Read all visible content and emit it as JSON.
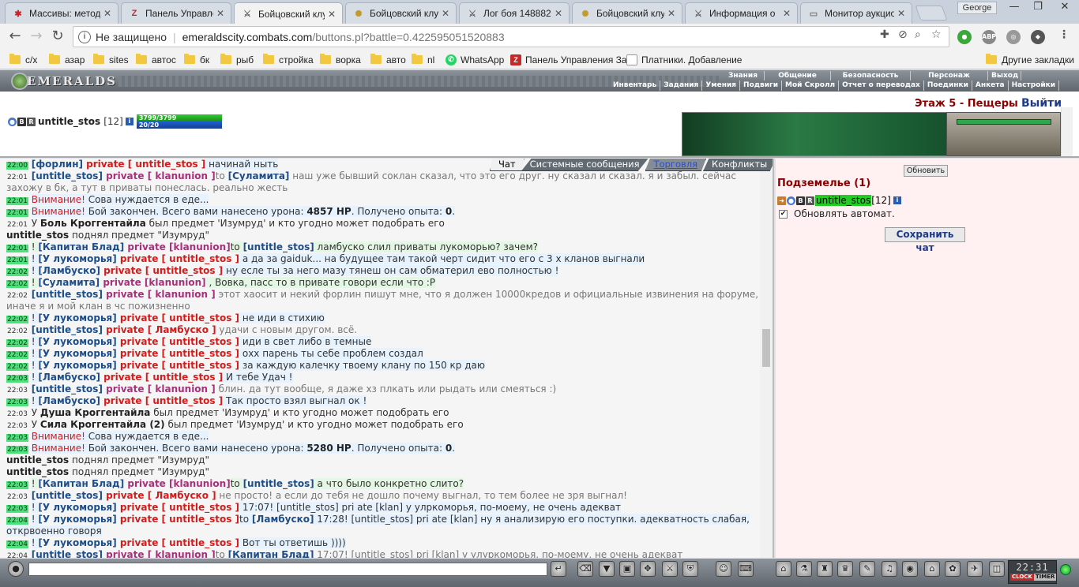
{
  "browser": {
    "tabs": [
      {
        "title": "Массивы: метод",
        "icon_color": "#c62828",
        "icon_glyph": "✱"
      },
      {
        "title": "Панель Управле",
        "icon_color": "#c62828",
        "icon_glyph": "Z"
      },
      {
        "title": "Бойцовский клу",
        "icon_color": "#666666",
        "icon_glyph": "⚔",
        "active": true
      },
      {
        "title": "Бойцовский клу",
        "icon_color": "#c29a2a",
        "icon_glyph": "✺"
      },
      {
        "title": "Лог боя 148882",
        "icon_color": "#666666",
        "icon_glyph": "⚔"
      },
      {
        "title": "Бойцовский клу",
        "icon_color": "#c29a2a",
        "icon_glyph": "✺"
      },
      {
        "title": "Информация о",
        "icon_color": "#666666",
        "icon_glyph": "⚔"
      },
      {
        "title": "Монитор аукцио",
        "icon_color": "#777777",
        "icon_glyph": "▭"
      }
    ],
    "profile_name": "George",
    "address": {
      "security_label": "Не защищено",
      "host": "emeraldscity.combats.com",
      "path": "/buttons.pl?battle=0.422595051520883"
    },
    "bookmarks": [
      {
        "label": "с/х",
        "type": "folder"
      },
      {
        "label": "азар",
        "type": "folder"
      },
      {
        "label": "sites",
        "type": "folder"
      },
      {
        "label": "автос",
        "type": "folder"
      },
      {
        "label": "бк",
        "type": "folder"
      },
      {
        "label": "рыб",
        "type": "folder"
      },
      {
        "label": "стройка",
        "type": "folder"
      },
      {
        "label": "ворка",
        "type": "folder"
      },
      {
        "label": "авто",
        "type": "folder"
      },
      {
        "label": "nl",
        "type": "folder"
      },
      {
        "label": "WhatsApp",
        "type": "whatsapp"
      },
      {
        "label": "Панель Управления За",
        "type": "panel"
      },
      {
        "label": "Платники. Добавление",
        "type": "page"
      }
    ],
    "other_bookmarks": "Другие закладки"
  },
  "game": {
    "logo_text": "EMERALDS",
    "menu_top": [
      "Знания",
      "Общение",
      "Безопасность",
      "Персонаж",
      "Выход"
    ],
    "menu_bottom": [
      "Инвентарь",
      "Задания",
      "Умения",
      "Подвиги",
      "Мой Скролл",
      "Отчет о переводах",
      "Поединки",
      "Анкета",
      "Настройки"
    ],
    "player": {
      "name": "untitle_stos",
      "level": "[12]",
      "hp": "3799/3799",
      "mp": "20/20",
      "hp_fraction": 1.0,
      "mp_fraction": 1.0
    },
    "location": "Этаж 5 - Пещеры",
    "exit_label": "Выйти",
    "chat_tabs": [
      "Чат",
      "Системные сообщения",
      "Торговля",
      "Конфликты"
    ],
    "right_panel": {
      "refresh_label": "Обновить",
      "room_title": "Подземелье (1)",
      "room_user": "untitle_stos",
      "room_user_level": "[12]",
      "auto_refresh_label": "Обновлять автомат.",
      "save_chat_label": "Сохранить чат"
    },
    "clock": {
      "time": "22:31",
      "label_clock": "CLOCK",
      "label_timer": "TIMER"
    }
  },
  "chat": [
    {
      "time": "22:00",
      "hl": true,
      "segs": [
        {
          "c": "nick",
          "t": "[форлин]"
        },
        {
          "c": "priv",
          "t": " private [ untitle_stos ]"
        },
        {
          "c": "",
          "t": " начинай ныть"
        }
      ]
    },
    {
      "time": "22:01",
      "segs": [
        {
          "c": "nick",
          "t": "[untitle_stos]"
        },
        {
          "c": "privp",
          "t": " private [ klanunion ]"
        },
        {
          "c": "grey",
          "t": "to "
        },
        {
          "c": "nick",
          "t": "[Суламита]"
        },
        {
          "c": "grey",
          "t": " наш уже бывший соклан сказал, что это его друг. ну сказал и сказал. я и забыл. сейчас захожу в бк, а тут в приваты понеслась. реально жесть"
        }
      ]
    },
    {
      "time": "22:01",
      "hl": true,
      "segs": [
        {
          "c": "warn",
          "t": "Внимание!"
        },
        {
          "c": "",
          "t": " Сова нуждается в еде..."
        }
      ]
    },
    {
      "time": "22:01",
      "hl": true,
      "segs": [
        {
          "c": "warn",
          "t": "Внимание!"
        },
        {
          "c": "",
          "t": " Бой закончен. Всего вами нанесено урона: "
        },
        {
          "c": "bold",
          "t": "4857 HP"
        },
        {
          "c": "",
          "t": ". Получено опыта: "
        },
        {
          "c": "bold",
          "t": "0"
        },
        {
          "c": "",
          "t": "."
        }
      ]
    },
    {
      "time": "22:01",
      "segs": [
        {
          "c": "",
          "t": "У "
        },
        {
          "c": "bold",
          "t": "Боль Кроггентайла"
        },
        {
          "c": "",
          "t": " был предмет 'Изумруд' и кто угодно может подобрать его"
        }
      ]
    },
    {
      "time": "",
      "segs": [
        {
          "c": "bold",
          "t": "untitle_stos"
        },
        {
          "c": "",
          "t": " поднял предмет \"Изумруд\""
        }
      ]
    },
    {
      "time": "22:01",
      "hlg": true,
      "segs": [
        {
          "c": "",
          "t": "! "
        },
        {
          "c": "nick",
          "t": "[Капитан Блад]"
        },
        {
          "c": "privp",
          "t": " private [klanunion]"
        },
        {
          "c": "",
          "t": "to "
        },
        {
          "c": "nick",
          "t": "[untitle_stos]"
        },
        {
          "c": "",
          "t": " ламбуско слил приваты лукоморью? зачем?"
        }
      ]
    },
    {
      "time": "22:01",
      "hl": true,
      "segs": [
        {
          "c": "",
          "t": "! "
        },
        {
          "c": "nick",
          "t": "[У лукоморья]"
        },
        {
          "c": "priv",
          "t": " private [ untitle_stos ]"
        },
        {
          "c": "",
          "t": " а да за gaiduk... на будущее там такой черт сидит что его с 3 х кланов выгнали"
        }
      ]
    },
    {
      "time": "22:02",
      "hl": true,
      "segs": [
        {
          "c": "",
          "t": "! "
        },
        {
          "c": "nick",
          "t": "[Ламбуско]"
        },
        {
          "c": "priv",
          "t": " private [ untitle_stos ]"
        },
        {
          "c": "",
          "t": " ну есле ты за него мазу тянеш он сам обматерил ево полностью !"
        }
      ]
    },
    {
      "time": "22:02",
      "hlg": true,
      "segs": [
        {
          "c": "",
          "t": "! "
        },
        {
          "c": "nick",
          "t": "[Суламита]"
        },
        {
          "c": "privp",
          "t": " private [klanunion]"
        },
        {
          "c": "",
          "t": " , Вовка, пасс то в привате говори если что :P"
        }
      ]
    },
    {
      "time": "22:02",
      "segs": [
        {
          "c": "nick",
          "t": "[untitle_stos]"
        },
        {
          "c": "privp",
          "t": " private [ klanunion ]"
        },
        {
          "c": "grey",
          "t": " этот хаосит и некий форлин пишут мне, что я должен 10000кредов и официальные извинения на форуме, иначе я и мой клан в чс пожизненно"
        }
      ]
    },
    {
      "time": "22:02",
      "hl": true,
      "segs": [
        {
          "c": "",
          "t": "! "
        },
        {
          "c": "nick",
          "t": "[У лукоморья]"
        },
        {
          "c": "priv",
          "t": " private [ untitle_stos ]"
        },
        {
          "c": "",
          "t": " не иди в стихию"
        }
      ]
    },
    {
      "time": "22:02",
      "segs": [
        {
          "c": "nick",
          "t": "[untitle_stos]"
        },
        {
          "c": "priv",
          "t": " private [ Ламбуско ]"
        },
        {
          "c": "grey",
          "t": " удачи с новым другом. всё."
        }
      ]
    },
    {
      "time": "22:02",
      "hl": true,
      "segs": [
        {
          "c": "",
          "t": "! "
        },
        {
          "c": "nick",
          "t": "[У лукоморья]"
        },
        {
          "c": "priv",
          "t": " private [ untitle_stos ]"
        },
        {
          "c": "",
          "t": " иди в свет либо в темные"
        }
      ]
    },
    {
      "time": "22:02",
      "hl": true,
      "segs": [
        {
          "c": "",
          "t": "! "
        },
        {
          "c": "nick",
          "t": "[У лукоморья]"
        },
        {
          "c": "priv",
          "t": " private [ untitle_stos ]"
        },
        {
          "c": "",
          "t": " охх парень ты себе проблем создал"
        }
      ]
    },
    {
      "time": "22:02",
      "hl": true,
      "segs": [
        {
          "c": "",
          "t": "! "
        },
        {
          "c": "nick",
          "t": "[У лукоморья]"
        },
        {
          "c": "priv",
          "t": " private [ untitle_stos ]"
        },
        {
          "c": "",
          "t": " за каждую калечку твоему клану по 150 кр даю"
        }
      ]
    },
    {
      "time": "22:03",
      "hl": true,
      "segs": [
        {
          "c": "",
          "t": "! "
        },
        {
          "c": "nick",
          "t": "[Ламбуско]"
        },
        {
          "c": "priv",
          "t": " private [ untitle_stos ]"
        },
        {
          "c": "",
          "t": " И тебе Удач !"
        }
      ]
    },
    {
      "time": "22:03",
      "segs": [
        {
          "c": "nick",
          "t": "[untitle_stos]"
        },
        {
          "c": "privp",
          "t": " private [ klanunion ]"
        },
        {
          "c": "grey",
          "t": " блин. да тут вообще, я даже хз плкать или рыдать или смеяться :)"
        }
      ]
    },
    {
      "time": "22:03",
      "hl": true,
      "segs": [
        {
          "c": "",
          "t": "! "
        },
        {
          "c": "nick",
          "t": "[Ламбуско]"
        },
        {
          "c": "priv",
          "t": " private [ untitle_stos ]"
        },
        {
          "c": "",
          "t": " Так просто взял выгнал ок !"
        }
      ]
    },
    {
      "time": "22:03",
      "segs": [
        {
          "c": "",
          "t": "У "
        },
        {
          "c": "bold",
          "t": "Душа Кроггентайла"
        },
        {
          "c": "",
          "t": " был предмет 'Изумруд' и кто угодно может подобрать его"
        }
      ]
    },
    {
      "time": "22:03",
      "segs": [
        {
          "c": "",
          "t": "У "
        },
        {
          "c": "bold",
          "t": "Сила Кроггентайла (2)"
        },
        {
          "c": "",
          "t": " был предмет 'Изумруд' и кто угодно может подобрать его"
        }
      ]
    },
    {
      "time": "22:03",
      "hl": true,
      "segs": [
        {
          "c": "warn",
          "t": "Внимание!"
        },
        {
          "c": "",
          "t": " Сова нуждается в еде..."
        }
      ]
    },
    {
      "time": "22:03",
      "hl": true,
      "segs": [
        {
          "c": "warn",
          "t": "Внимание!"
        },
        {
          "c": "",
          "t": " Бой закончен. Всего вами нанесено урона: "
        },
        {
          "c": "bold",
          "t": "5280 HP"
        },
        {
          "c": "",
          "t": ". Получено опыта: "
        },
        {
          "c": "bold",
          "t": "0"
        },
        {
          "c": "",
          "t": "."
        }
      ]
    },
    {
      "time": "",
      "segs": [
        {
          "c": "bold",
          "t": "untitle_stos"
        },
        {
          "c": "",
          "t": " поднял предмет \"Изумруд\""
        }
      ]
    },
    {
      "time": "",
      "segs": [
        {
          "c": "bold",
          "t": "untitle_stos"
        },
        {
          "c": "",
          "t": " поднял предмет \"Изумруд\""
        }
      ]
    },
    {
      "time": "22:03",
      "hlg": true,
      "segs": [
        {
          "c": "",
          "t": "! "
        },
        {
          "c": "nick",
          "t": "[Капитан Блад]"
        },
        {
          "c": "privp",
          "t": " private [klanunion]"
        },
        {
          "c": "",
          "t": "to "
        },
        {
          "c": "nick",
          "t": "[untitle_stos]"
        },
        {
          "c": "",
          "t": " а что было конкретно слито?"
        }
      ]
    },
    {
      "time": "22:03",
      "segs": [
        {
          "c": "nick",
          "t": "[untitle_stos]"
        },
        {
          "c": "priv",
          "t": " private [ Ламбуско ]"
        },
        {
          "c": "grey",
          "t": " не просто! а если до тебя не дошло почему выгнал, то тем более не зря выгнал!"
        }
      ]
    },
    {
      "time": "22:03",
      "hl": true,
      "segs": [
        {
          "c": "",
          "t": "! "
        },
        {
          "c": "nick",
          "t": "[У лукоморья]"
        },
        {
          "c": "priv",
          "t": " private [ untitle_stos ]"
        },
        {
          "c": "",
          "t": " 17:07! [untitle_stos] pri ate [klan] у улркоморья, по-моему, не очень адекват"
        }
      ]
    },
    {
      "time": "22:04",
      "hl": true,
      "segs": [
        {
          "c": "",
          "t": "! "
        },
        {
          "c": "nick",
          "t": "[У лукоморья]"
        },
        {
          "c": "priv",
          "t": " private [ untitle_stos ]"
        },
        {
          "c": "",
          "t": "to "
        },
        {
          "c": "nick",
          "t": "[Ламбуско]"
        },
        {
          "c": "",
          "t": " 17:28! [untitle_stos] pri ate [klan] ну я анализирую его поступки. адекватность слабая, открвоенно говоря"
        }
      ]
    },
    {
      "time": "22:04",
      "hl": true,
      "segs": [
        {
          "c": "",
          "t": "! "
        },
        {
          "c": "nick",
          "t": "[У лукоморья]"
        },
        {
          "c": "priv",
          "t": " private [ untitle_stos ]"
        },
        {
          "c": "",
          "t": " Вот ты ответишь ))))"
        }
      ]
    },
    {
      "time": "22:04",
      "segs": [
        {
          "c": "nick",
          "t": "[untitle_stos]"
        },
        {
          "c": "privp",
          "t": " private [ klanunion ]"
        },
        {
          "c": "grey",
          "t": "to "
        },
        {
          "c": "nick",
          "t": "[Капитан Блад]"
        },
        {
          "c": "grey",
          "t": " 17:07! [untitle_stos] pri [klan] у улуркоморья, по-моему, не очень адекват"
        }
      ]
    }
  ],
  "colors": {
    "accent": "#1e3a8a",
    "alert": "#d41c1c",
    "timestamp_bg": "#4ee07a",
    "room_user_bg": "#22cc22"
  }
}
